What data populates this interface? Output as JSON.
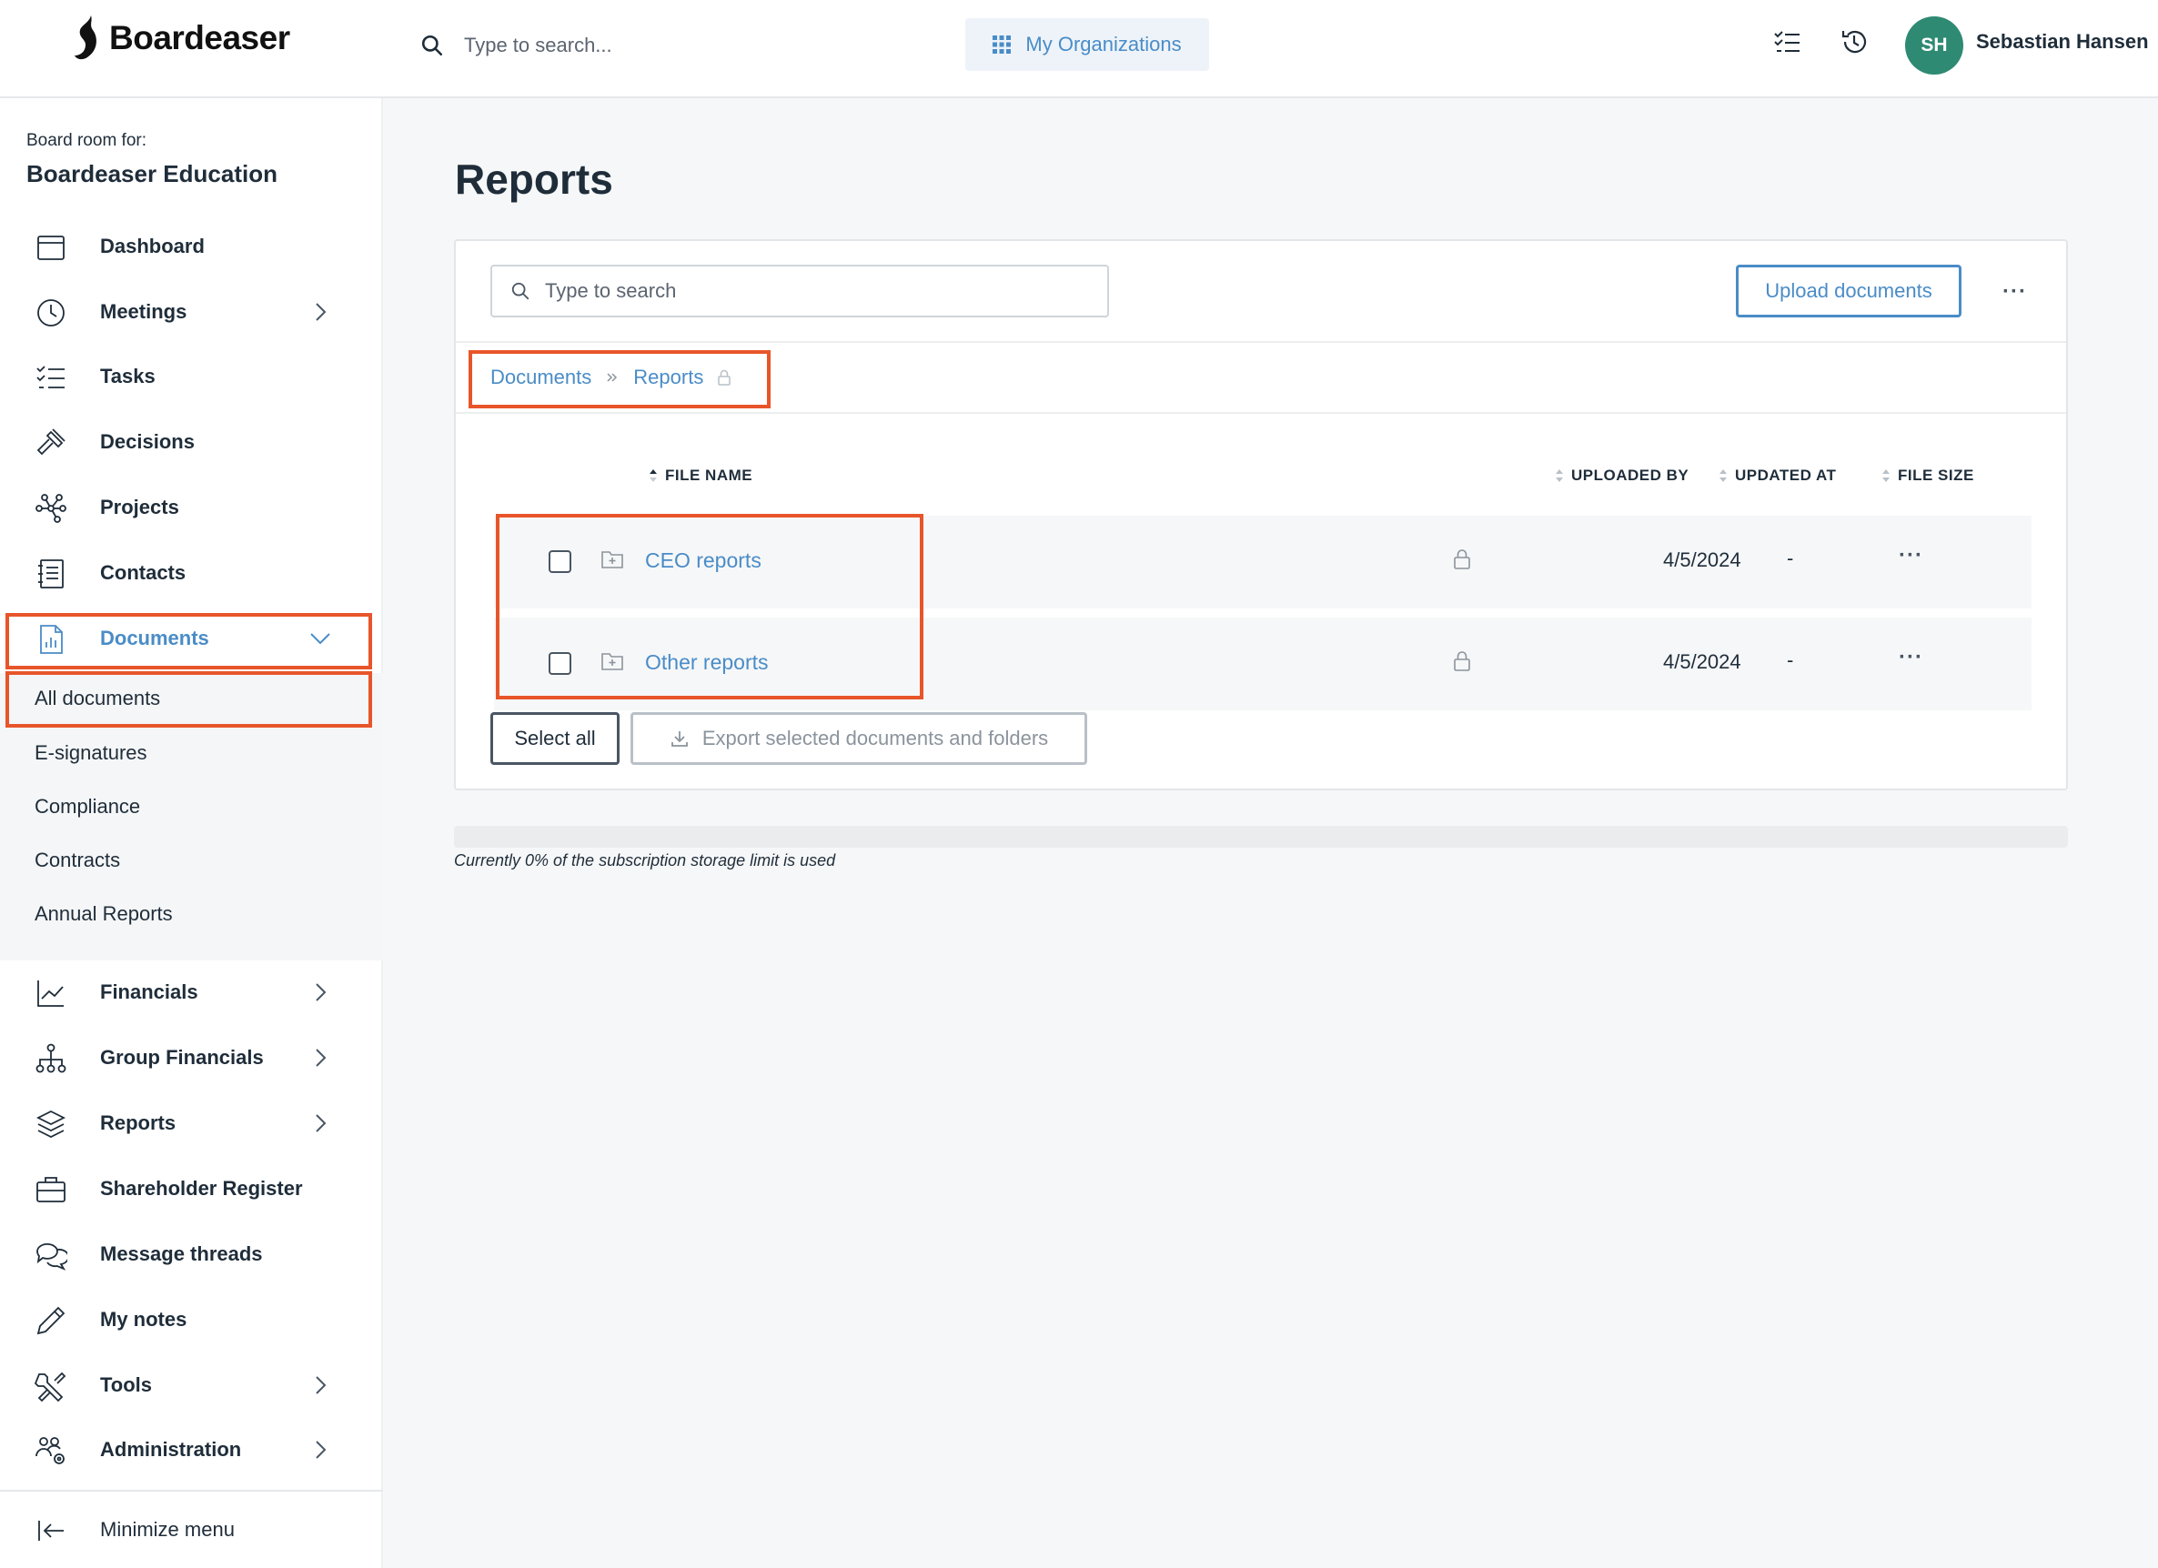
{
  "brand": {
    "name": "Boardeaser"
  },
  "topbar": {
    "search_placeholder": "Type to search...",
    "org_button": "My Organizations",
    "user": {
      "initials": "SH",
      "name": "Sebastian Hansen"
    }
  },
  "sidebar": {
    "board_for": "Board room for:",
    "board_name": "Boardeaser Education",
    "items": [
      {
        "label": "Dashboard",
        "icon": "calendar-icon"
      },
      {
        "label": "Meetings",
        "icon": "clock-icon"
      },
      {
        "label": "Tasks",
        "icon": "checklist-icon"
      },
      {
        "label": "Decisions",
        "icon": "gavel-icon"
      },
      {
        "label": "Projects",
        "icon": "network-icon"
      },
      {
        "label": "Contacts",
        "icon": "contacts-book-icon"
      },
      {
        "label": "Documents",
        "icon": "document-chart-icon"
      }
    ],
    "documents_sub": [
      "All documents",
      "E-signatures",
      "Compliance",
      "Contracts",
      "Annual Reports"
    ],
    "items_lower": [
      {
        "label": "Financials",
        "icon": "line-chart-icon"
      },
      {
        "label": "Group Financials",
        "icon": "org-chart-icon"
      },
      {
        "label": "Reports",
        "icon": "layers-icon"
      },
      {
        "label": "Shareholder Register",
        "icon": "briefcase-icon"
      },
      {
        "label": "Message threads",
        "icon": "chat-bubbles-icon"
      },
      {
        "label": "My notes",
        "icon": "pencil-icon"
      },
      {
        "label": "Tools",
        "icon": "tools-icon"
      },
      {
        "label": "Administration",
        "icon": "users-gear-icon"
      }
    ],
    "minimize": "Minimize menu"
  },
  "main": {
    "title": "Reports",
    "search_placeholder": "Type to search",
    "upload_button": "Upload documents",
    "breadcrumb": [
      "Documents",
      "Reports"
    ],
    "columns": [
      "FILE NAME",
      "UPLOADED BY",
      "UPDATED AT",
      "FILE SIZE"
    ],
    "rows": [
      {
        "name": "CEO reports",
        "updated": "4/5/2024",
        "size": "-"
      },
      {
        "name": "Other reports",
        "updated": "4/5/2024",
        "size": "-"
      }
    ],
    "select_all": "Select all",
    "export_button": "Export selected documents and folders",
    "storage_percent": 0,
    "storage_text": "Currently 0% of the subscription storage limit is used"
  },
  "colors": {
    "accent": "#4a8cc7",
    "highlight": "#e8552a",
    "avatar": "#2e8a72"
  }
}
